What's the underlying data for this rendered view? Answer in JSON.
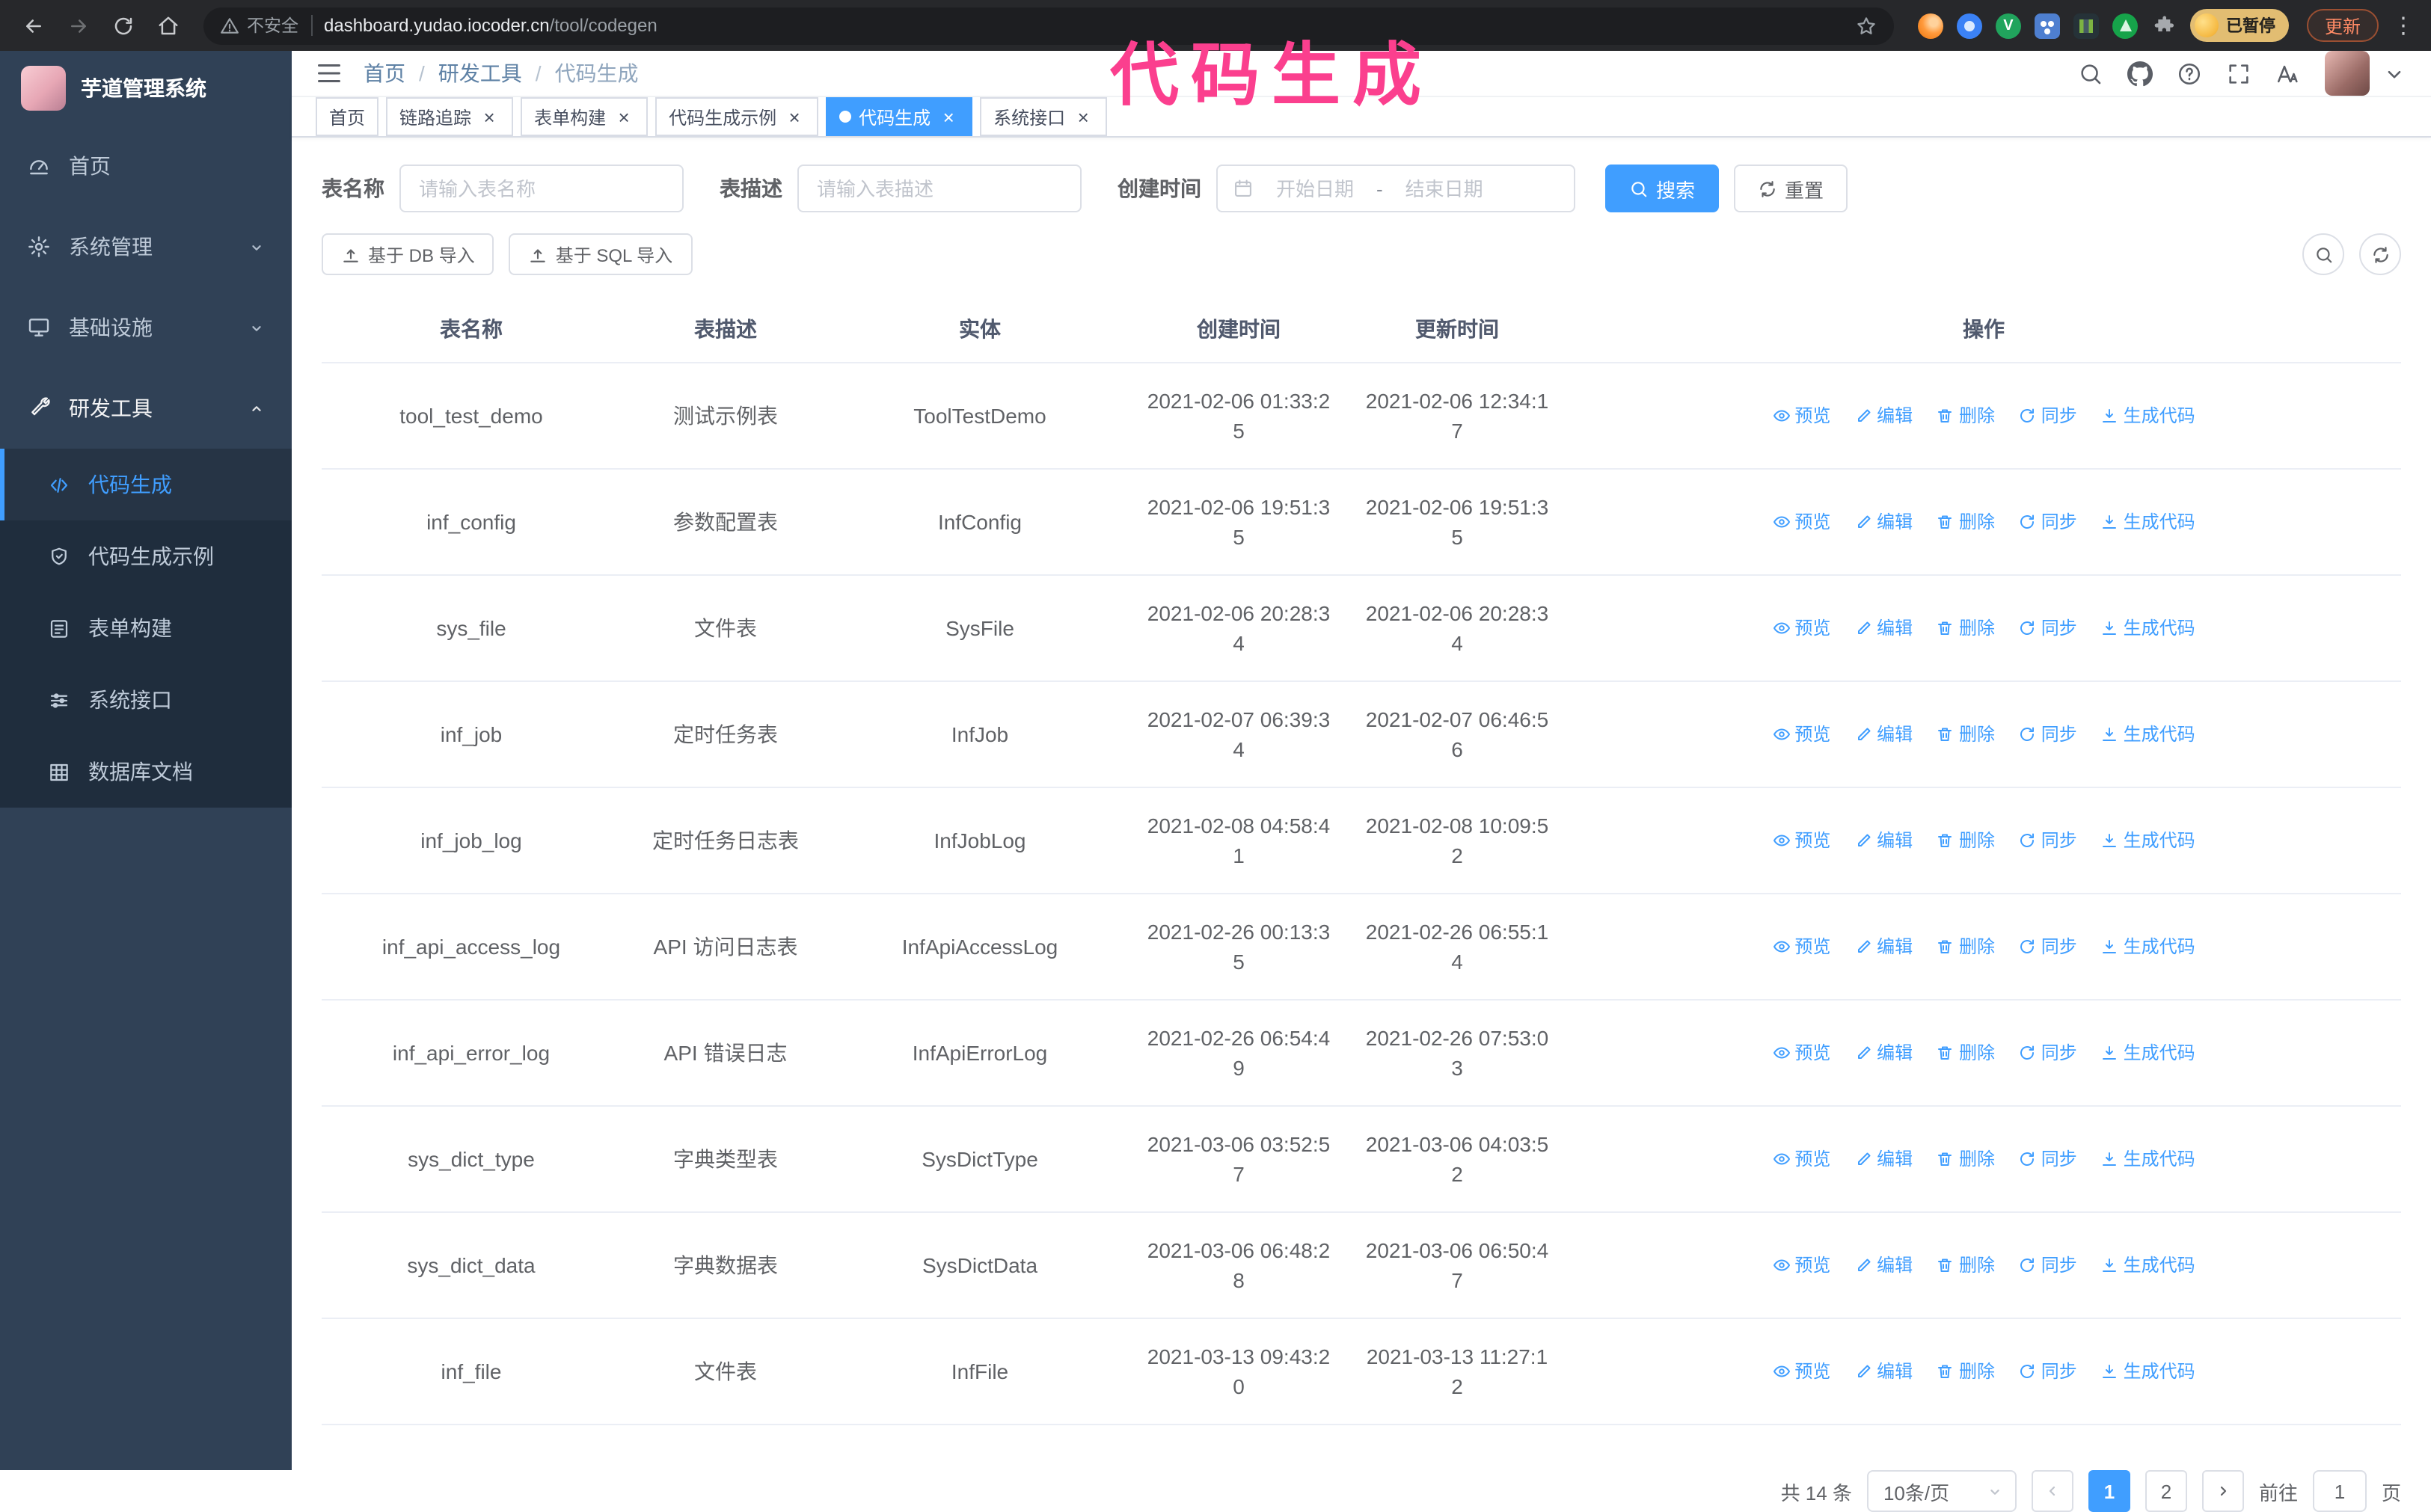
{
  "theme": {
    "accent_blue": "#409eff",
    "sidebar_bg": "#304156",
    "sidebar_submenu_bg": "#1f2d3d",
    "sidebar_text": "#bfcbd9",
    "annotation_pink": "#fb3f8e",
    "browser_toolbar_bg": "#27282b",
    "table_border": "#ebeef5"
  },
  "browser": {
    "security_label": "不安全",
    "url_host": "dashboard.yudao.iocoder.cn",
    "url_path": "/tool/codegen",
    "profile_badge": "已暂停",
    "update_button": "更新"
  },
  "annotation": "代码生成",
  "sidebar": {
    "logo_title": "芋道管理系统",
    "items": [
      {
        "label": "首页"
      },
      {
        "label": "系统管理"
      },
      {
        "label": "基础设施"
      },
      {
        "label": "研发工具"
      }
    ],
    "sub_items": [
      {
        "label": "代码生成"
      },
      {
        "label": "代码生成示例"
      },
      {
        "label": "表单构建"
      },
      {
        "label": "系统接口"
      },
      {
        "label": "数据库文档"
      }
    ]
  },
  "header": {
    "breadcrumb": [
      "首页",
      "研发工具",
      "代码生成"
    ],
    "separator": "/"
  },
  "tabs": [
    {
      "label": "首页"
    },
    {
      "label": "链路追踪"
    },
    {
      "label": "表单构建"
    },
    {
      "label": "代码生成示例"
    },
    {
      "label": "代码生成"
    },
    {
      "label": "系统接口"
    }
  ],
  "filters": {
    "table_name_label": "表名称",
    "table_name_placeholder": "请输入表名称",
    "table_desc_label": "表描述",
    "table_desc_placeholder": "请输入表描述",
    "create_time_label": "创建时间",
    "date_start_placeholder": "开始日期",
    "date_separator": "-",
    "date_end_placeholder": "结束日期",
    "search_button": "搜索",
    "reset_button": "重置"
  },
  "toolbar": {
    "import_db_button": "基于 DB 导入",
    "import_sql_button": "基于 SQL 导入"
  },
  "table": {
    "columns": [
      "表名称",
      "表描述",
      "实体",
      "创建时间",
      "更新时间",
      "操作"
    ],
    "actions": [
      "预览",
      "编辑",
      "删除",
      "同步",
      "生成代码"
    ],
    "rows": [
      {
        "name": "tool_test_demo",
        "desc": "测试示例表",
        "entity": "ToolTestDemo",
        "created": "2021-02-06 01:33:25",
        "updated": "2021-02-06 12:34:17"
      },
      {
        "name": "inf_config",
        "desc": "参数配置表",
        "entity": "InfConfig",
        "created": "2021-02-06 19:51:35",
        "updated": "2021-02-06 19:51:35"
      },
      {
        "name": "sys_file",
        "desc": "文件表",
        "entity": "SysFile",
        "created": "2021-02-06 20:28:34",
        "updated": "2021-02-06 20:28:34"
      },
      {
        "name": "inf_job",
        "desc": "定时任务表",
        "entity": "InfJob",
        "created": "2021-02-07 06:39:34",
        "updated": "2021-02-07 06:46:56"
      },
      {
        "name": "inf_job_log",
        "desc": "定时任务日志表",
        "entity": "InfJobLog",
        "created": "2021-02-08 04:58:41",
        "updated": "2021-02-08 10:09:52"
      },
      {
        "name": "inf_api_access_log",
        "desc": "API 访问日志表",
        "entity": "InfApiAccessLog",
        "created": "2021-02-26 00:13:35",
        "updated": "2021-02-26 06:55:14"
      },
      {
        "name": "inf_api_error_log",
        "desc": "API 错误日志",
        "entity": "InfApiErrorLog",
        "created": "2021-02-26 06:54:49",
        "updated": "2021-02-26 07:53:03"
      },
      {
        "name": "sys_dict_type",
        "desc": "字典类型表",
        "entity": "SysDictType",
        "created": "2021-03-06 03:52:57",
        "updated": "2021-03-06 04:03:52"
      },
      {
        "name": "sys_dict_data",
        "desc": "字典数据表",
        "entity": "SysDictData",
        "created": "2021-03-06 06:48:28",
        "updated": "2021-03-06 06:50:47"
      },
      {
        "name": "inf_file",
        "desc": "文件表",
        "entity": "InfFile",
        "created": "2021-03-13 09:43:20",
        "updated": "2021-03-13 11:27:12"
      }
    ]
  },
  "pagination": {
    "total": "共 14 条",
    "page_size": "10条/页",
    "pages": [
      "1",
      "2"
    ],
    "goto_label": "前往",
    "goto_value": "1",
    "unit_label": "页"
  }
}
